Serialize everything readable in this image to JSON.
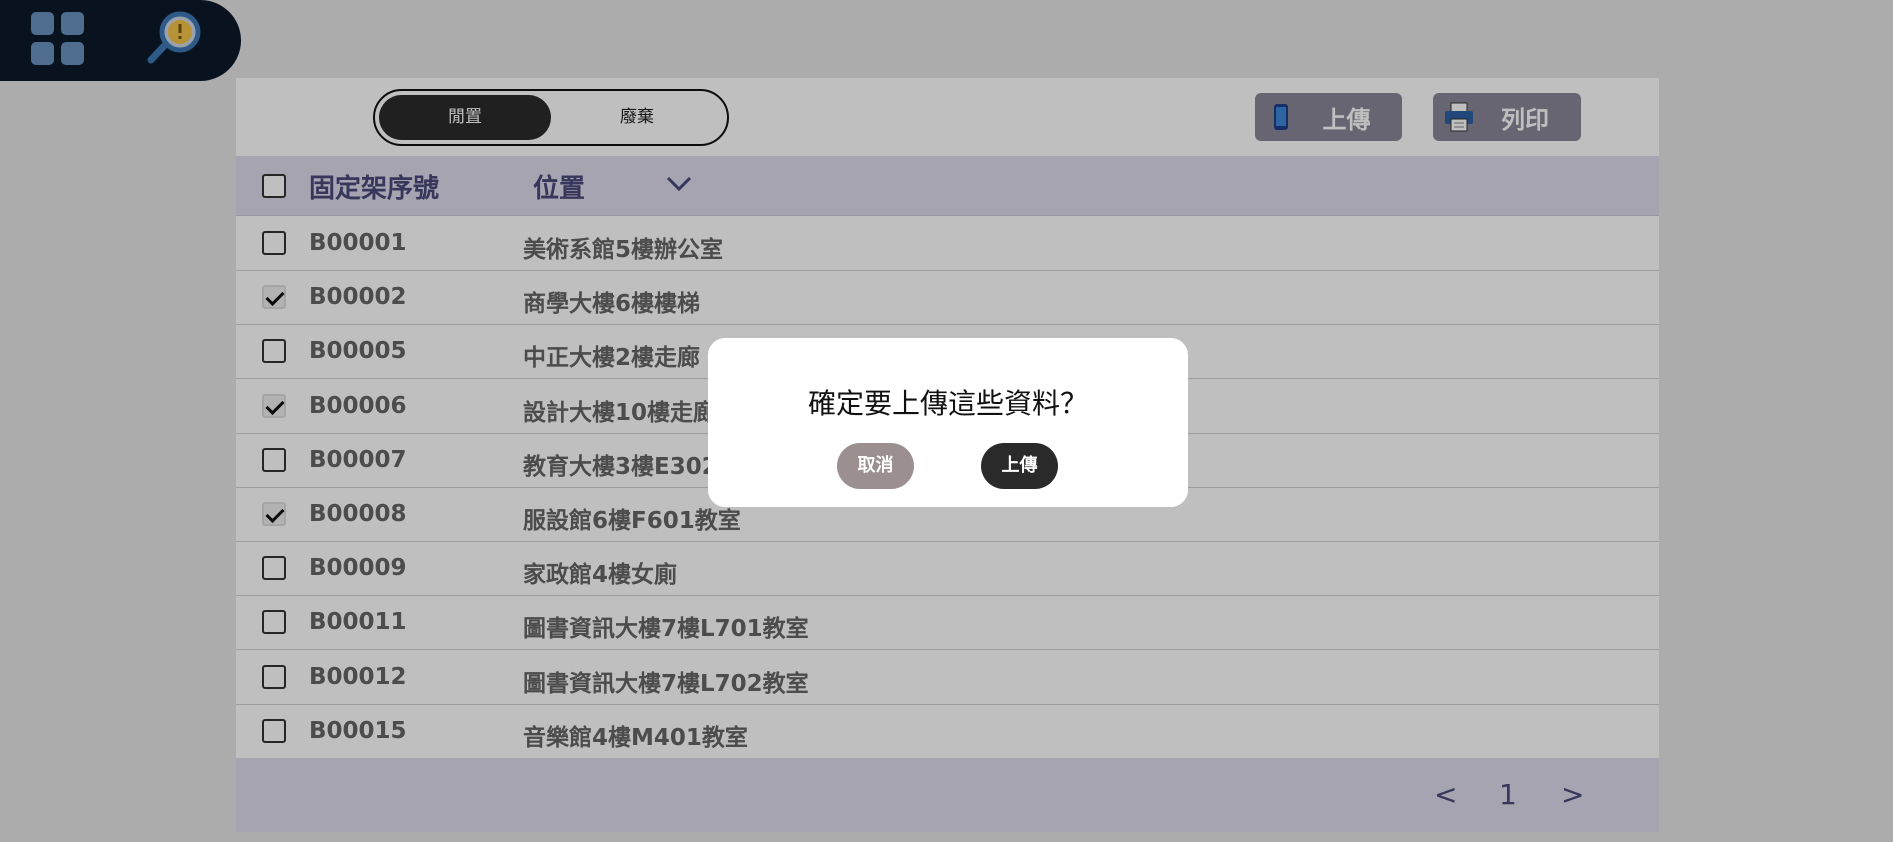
{
  "toggle": {
    "active": "閒置",
    "inactive": "廢棄"
  },
  "toolbar": {
    "upload_label": "上傳",
    "print_label": "列印"
  },
  "table": {
    "headers": {
      "id": "固定架序號",
      "location": "位置"
    },
    "rows": [
      {
        "id": "B00001",
        "location": "美術系館5樓辦公室",
        "checked": false
      },
      {
        "id": "B00002",
        "location": "商學大樓6樓樓梯",
        "checked": true
      },
      {
        "id": "B00005",
        "location": "中正大樓2樓走廊",
        "checked": false
      },
      {
        "id": "B00006",
        "location": "設計大樓10樓走廊",
        "checked": true
      },
      {
        "id": "B00007",
        "location": "教育大樓3樓E302",
        "checked": false
      },
      {
        "id": "B00008",
        "location": "服設館6樓F601教室",
        "checked": true
      },
      {
        "id": "B00009",
        "location": "家政館4樓女廁",
        "checked": false
      },
      {
        "id": "B00011",
        "location": "圖書資訊大樓7樓L701教室",
        "checked": false
      },
      {
        "id": "B00012",
        "location": "圖書資訊大樓7樓L702教室",
        "checked": false
      },
      {
        "id": "B00015",
        "location": "音樂館4樓M401教室",
        "checked": false
      }
    ]
  },
  "pagination": {
    "prev": "<",
    "page": "1",
    "next": ">"
  },
  "dialog": {
    "title": "確定要上傳這些資料？",
    "cancel_label": "取消",
    "confirm_label": "上傳"
  },
  "colors": {
    "topbar": "#0c1a2b",
    "header_bg": "#dcdbeb",
    "toolbar_button": "#8a8799",
    "dialog_cancel": "#9b8f8f",
    "dialog_confirm": "#2a2a2a"
  }
}
